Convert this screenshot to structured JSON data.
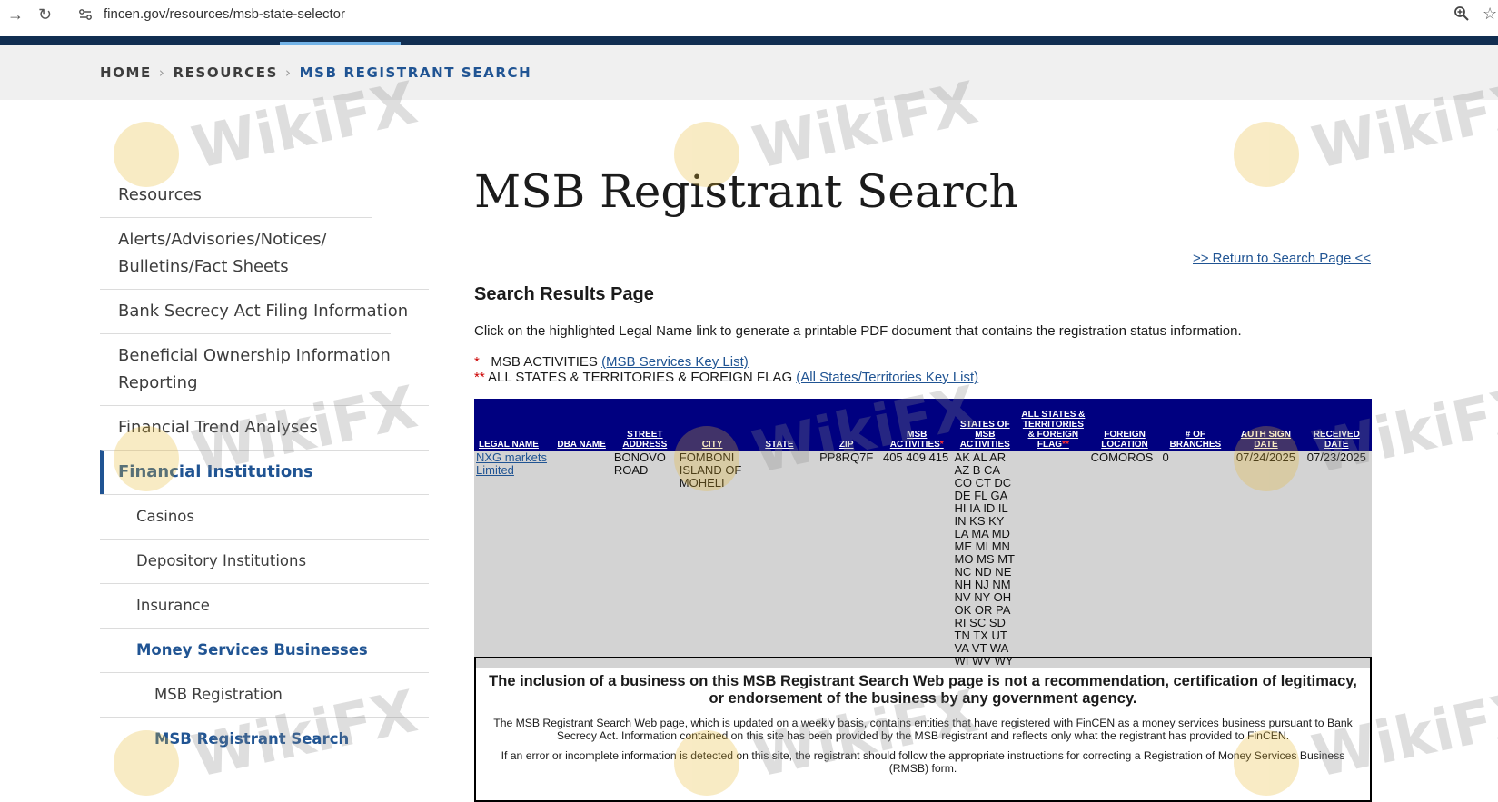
{
  "browser": {
    "url": "fincen.gov/resources/msb-state-selector",
    "back_icon": "arrow-right-icon",
    "reload_icon": "reload-icon"
  },
  "breadcrumb": {
    "home": "HOME",
    "resources": "RESOURCES",
    "current": "MSB REGISTRANT SEARCH"
  },
  "sidebar": {
    "items": [
      {
        "label": "Resources"
      },
      {
        "label": "Alerts/Advisories/Notices/ Bulletins/Fact Sheets"
      },
      {
        "label": "Bank Secrecy Act Filing Information"
      },
      {
        "label": "Beneficial Ownership Information Reporting"
      },
      {
        "label": "Financial Trend Analyses"
      },
      {
        "label": "Financial Institutions"
      },
      {
        "label": "Casinos"
      },
      {
        "label": "Depository Institutions"
      },
      {
        "label": "Insurance"
      },
      {
        "label": "Money Services Businesses"
      },
      {
        "label": "MSB Registration"
      },
      {
        "label": "MSB Registrant Search"
      }
    ]
  },
  "main": {
    "title": "MSB Registrant Search",
    "return_link": ">> Return to Search Page <<",
    "results_heading": "Search Results Page",
    "instructions": "Click on the highlighted Legal Name link to generate a printable PDF document that contains the registration status information.",
    "key1_star": "*",
    "key1_text": "MSB ACTIVITIES",
    "key1_link": "(MSB Services Key List)",
    "key2_star": "**",
    "key2_text": "ALL STATES & TERRITORIES & FOREIGN FLAG",
    "key2_link": "(All States/Territories Key List)"
  },
  "table": {
    "headers": {
      "legal_name": "LEGAL NAME",
      "dba_name": "DBA NAME",
      "street_address": "STREET ADDRESS",
      "city": "CITY",
      "state": "STATE",
      "zip": "ZIP",
      "msb_activities": "MSB ACTIVITIES",
      "msb_activities_mark": "*",
      "states_of_msb": "STATES OF MSB ACTIVITIES",
      "all_states": "ALL STATES & TERRITORIES & FOREIGN FLAG",
      "all_states_mark": "**",
      "foreign_location": "FOREIGN LOCATION",
      "branches": "# OF BRANCHES",
      "auth_sign_date": "AUTH SIGN DATE",
      "received_date": "RECEIVED DATE"
    },
    "row": {
      "legal_name": "NXG markets Limited",
      "dba_name": "",
      "street_address": "BONOVO ROAD",
      "city": "FOMBONI ISLAND OF MOHELI",
      "state": "",
      "zip": "PP8RQ7F",
      "msb_activities": "405 409 415",
      "states": "AK AL AR AZ B CA CO CT DC DE FL GA HI IA ID IL IN KS KY LA MA MD ME MI MN MO MS MT NC ND NE NH NJ NM NV NY OH OK OR PA RI SC SD TN TX UT VA VT WA WI WV WY",
      "all_states": "",
      "foreign_location": "COMOROS",
      "branches": "0",
      "auth_sign_date": "07/24/2025",
      "received_date": "07/23/2025"
    }
  },
  "disclaimer": {
    "heading": "The inclusion of a business on this MSB Registrant Search Web page is not a recommendation, certification of legitimacy, or endorsement of the business by any government agency.",
    "para1": "The MSB Registrant Search Web page, which is updated on a weekly basis, contains entities that have registered with FinCEN as a money services business pursuant to Bank Secrecy Act. Information contained on this site has been provided by the MSB registrant and reflects only what the registrant has provided to FinCEN.",
    "para2": "If an error or incomplete information is detected on this site, the registrant should follow the appropriate instructions for correcting a Registration of Money Services Business (RMSB) form."
  },
  "watermark": {
    "text": "WikiFX",
    "color": "#e8b830"
  },
  "colors": {
    "navy": "#112e51",
    "link": "#205493",
    "table_header": "#000080",
    "table_row": "#d3d3d3"
  }
}
